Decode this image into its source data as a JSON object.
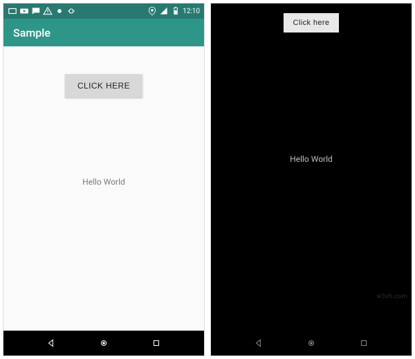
{
  "status": {
    "time": "12:10"
  },
  "app_bar": {
    "title": "Sample"
  },
  "left": {
    "button_label": "CLICK HERE",
    "body_text": "Hello World"
  },
  "right": {
    "button_label": "Click here",
    "body_text": "Hello World"
  },
  "watermark": "w3xh.com"
}
